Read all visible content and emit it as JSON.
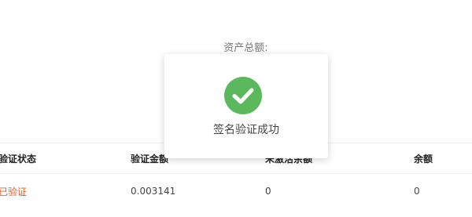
{
  "summary": {
    "total_assets_label": "资产总额:"
  },
  "table": {
    "columns": [
      "验证状态",
      "验证金额",
      "未激活余额",
      "余额"
    ],
    "rows": [
      {
        "status": "已验证",
        "amount": "0.003141",
        "inactive_balance": "0",
        "balance": "0"
      }
    ]
  },
  "toast": {
    "icon": "check-circle-icon",
    "message": "签名验证成功",
    "icon_color": "#5cb85c"
  },
  "colors": {
    "status_verified": "#e0602c"
  }
}
